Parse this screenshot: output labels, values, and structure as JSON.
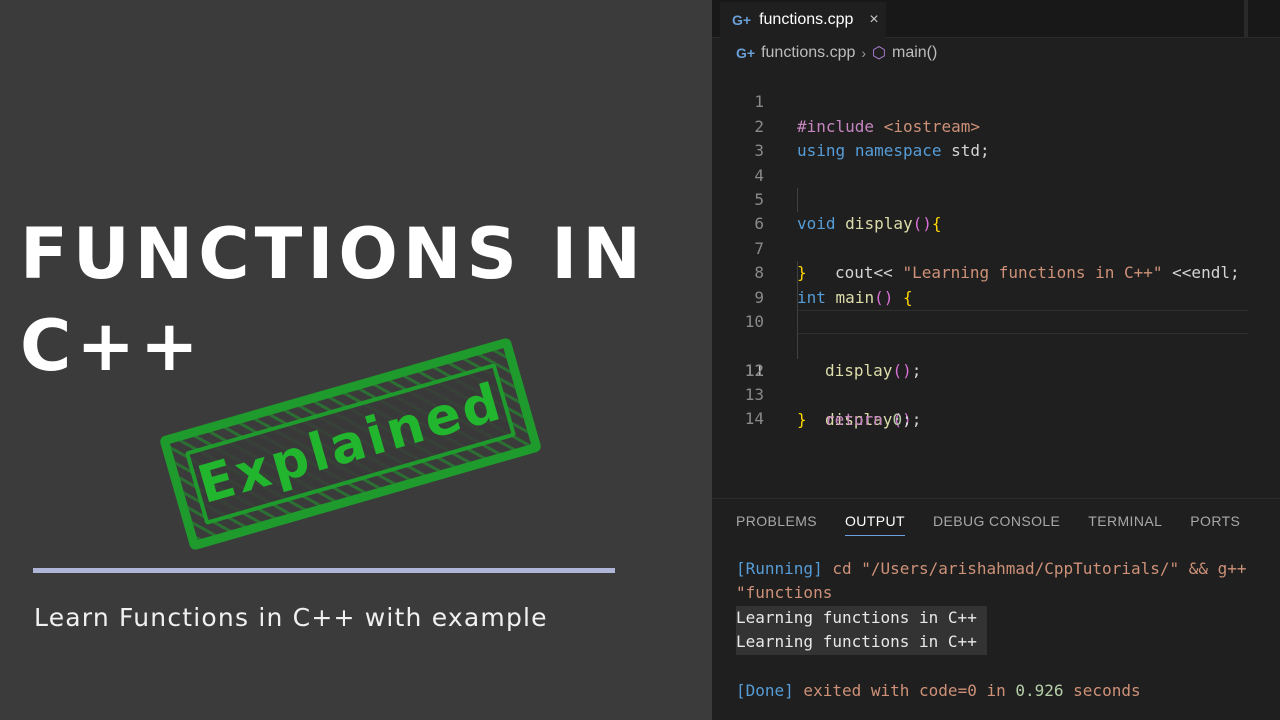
{
  "thumbnail": {
    "title_line1": "FUNCTIONS IN",
    "title_line2": "C++",
    "stamp_text": "Explained",
    "subtitle": "Learn Functions in C++ with example",
    "colors": {
      "background": "#3b3b3b",
      "stamp": "#22b52e",
      "divider": "#aeb5d6"
    }
  },
  "editor": {
    "tab": {
      "icon": "cpp-file-icon",
      "label": "functions.cpp",
      "close": "×"
    },
    "breadcrumb": {
      "file": "functions.cpp",
      "separator": "›",
      "symbol_icon": "cube-icon",
      "symbol": "main()"
    },
    "line_numbers": [
      "1",
      "2",
      "3",
      "4",
      "5",
      "6",
      "7",
      "8",
      "9",
      "10",
      "11",
      "12",
      "13",
      "14"
    ],
    "code": {
      "l1_include": "#include",
      "l1_header": "<iostream>",
      "l2_using": "using",
      "l2_namespace": "namespace",
      "l2_std": "std;",
      "l5_void": "void",
      "l5_name": "display",
      "l5_paren": "()",
      "l5_brace": "{",
      "l6_cout": "cout<< ",
      "l6_str": "\"Learning functions in C++\"",
      "l6_rest": " <<endl;",
      "l7_brace": "}",
      "l8_int": "int",
      "l8_name": "main",
      "l8_paren": "()",
      "l8_brace": "{",
      "l10_name": "display",
      "l10_paren": "()",
      "l10_semi": ";",
      "l11_name": "display",
      "l11_paren": "()",
      "l11_semi": ";",
      "l12_return": "return",
      "l12_zero": "0",
      "l12_semi": ";",
      "l13_brace": "}"
    }
  },
  "panel": {
    "tabs": [
      "PROBLEMS",
      "OUTPUT",
      "DEBUG CONSOLE",
      "TERMINAL",
      "PORTS"
    ],
    "active_tab": "OUTPUT",
    "output": {
      "running_tag": "[Running]",
      "running_cmd": " cd \"/Users/arishahmad/CppTutorials/\" && g++",
      "running_cont": "\"functions",
      "out1": "Learning functions in C++",
      "out2": "Learning functions in C++",
      "done_tag": "[Done]",
      "done_text1": " exited with ",
      "done_code": "code=0",
      "done_text2": " in ",
      "done_time": "0.926",
      "done_text3": " seconds"
    }
  }
}
